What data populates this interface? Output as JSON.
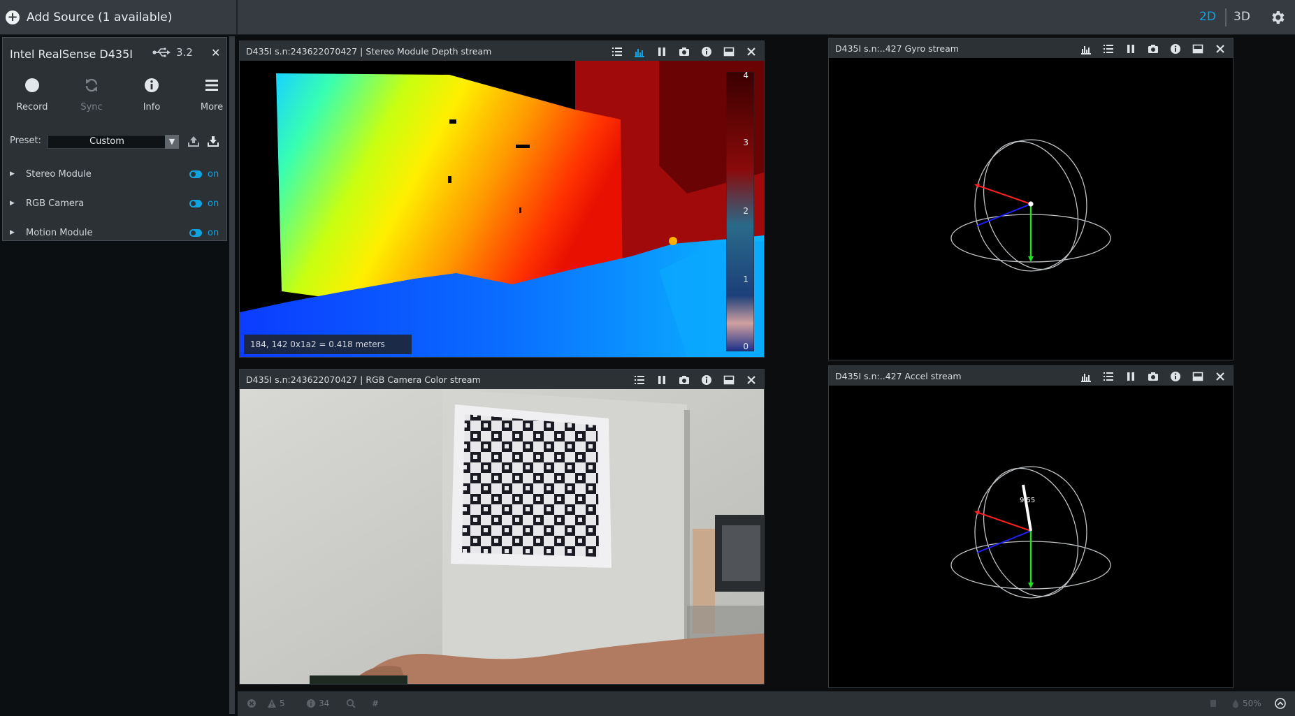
{
  "topbar": {
    "add_source": "Add Source (1 available)",
    "view_2d": "2D",
    "view_3d": "3D",
    "settings_icon": "gear-icon"
  },
  "device": {
    "name": "Intel RealSense D435I",
    "usb_version": "3.2",
    "actions": [
      {
        "label": "Record",
        "icon": "record-icon"
      },
      {
        "label": "Sync",
        "icon": "sync-icon"
      },
      {
        "label": "Info",
        "icon": "info-icon"
      },
      {
        "label": "More",
        "icon": "menu-icon"
      }
    ],
    "preset_label": "Preset:",
    "preset_value": "Custom",
    "modules": [
      {
        "name": "Stereo Module",
        "state": "on"
      },
      {
        "name": "RGB Camera",
        "state": "on"
      },
      {
        "name": "Motion Module",
        "state": "on"
      }
    ]
  },
  "streams": {
    "depth": {
      "title": "D435I s.n:243622070427 | Stereo Module Depth stream",
      "readout": "184, 142 0x1a2 = 0.418 meters",
      "scale_labels": [
        "4",
        "3",
        "2",
        "1",
        "0"
      ]
    },
    "color": {
      "title": "D435I s.n:243622070427 | RGB Camera Color stream"
    },
    "gyro": {
      "title": "D435I s.n:..427 Gyro stream"
    },
    "accel": {
      "title": "D435I s.n:..427 Accel stream",
      "magnitude": "9.55"
    }
  },
  "statusbar": {
    "warnings": "5",
    "infos": "34",
    "filter": "#",
    "percent": "50%"
  },
  "colors": {
    "accent": "#0fa3e0",
    "panel": "#2c3136",
    "topbar": "#353b41"
  }
}
